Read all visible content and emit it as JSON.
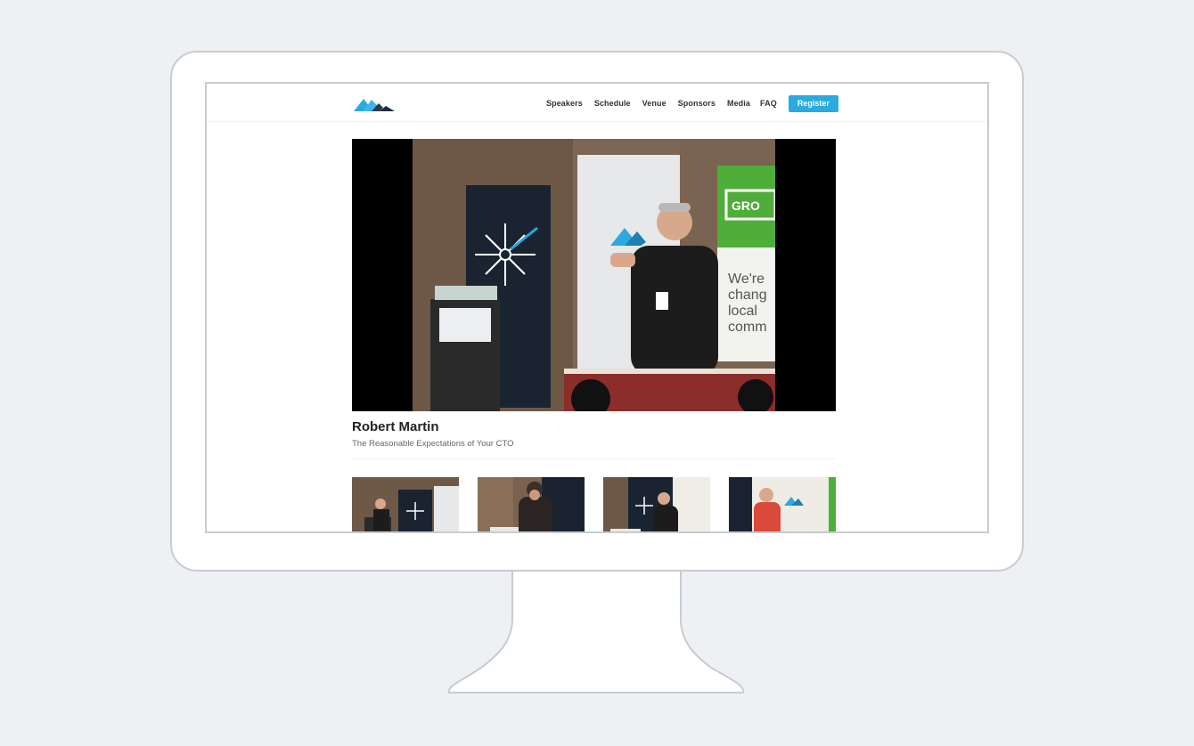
{
  "nav": {
    "items": [
      "Speakers",
      "Schedule",
      "Venue",
      "Sponsors",
      "Media",
      "FAQ"
    ],
    "register_label": "Register"
  },
  "video": {
    "speaker_name": "Robert Martin",
    "talk_title": "The Reasonable Expectations of Your CTO"
  },
  "colors": {
    "accent": "#2ba9e1",
    "background": "#eef1f4",
    "frame": "#c8cbcf"
  }
}
